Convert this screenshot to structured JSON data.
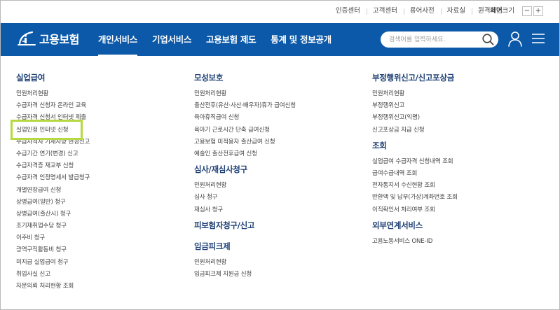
{
  "topbar": {
    "links": [
      "인증센터",
      "고객센터",
      "용어사전",
      "자료실",
      "원격제어"
    ],
    "zoom_label": "화면크기",
    "zoom_out": "−",
    "zoom_in": "+"
  },
  "header": {
    "logo_text": "고용보험",
    "nav": [
      "개인서비스",
      "기업서비스",
      "고용보험 제도",
      "통계 및 정보공개"
    ],
    "active_nav": "개인서비스",
    "search_placeholder": "검색어를 입력하세요.",
    "brand_color": "#0b59a8"
  },
  "sitemap": {
    "col1": {
      "title": "실업급여",
      "items": [
        "민원처리현황",
        "수급자격 신청자 온라인 교육",
        "수급자격 신청서 인터넷 제출",
        "실업인정 인터넷 신청",
        "수급자격자 기재사항 변경신고",
        "수급기간 연기(변경) 신고",
        "수급자격증 재교부 신청",
        "수급자격 인정명세서 발급청구",
        "개별연장급여 신청",
        "상병급여(일반) 청구",
        "상병급여(출산시) 청구",
        "조기재취업수당 청구",
        "이주비 청구",
        "광역구직활동비 청구",
        "미지급 실업급여 청구",
        "취업사실 신고",
        "자문의뢰 처리현황 조회"
      ]
    },
    "col2": [
      {
        "title": "모성보호",
        "items": [
          "민원처리현황",
          "출산전후(유산·사산·배우자)휴가 급여신청",
          "육아휴직급여 신청",
          "육아기 근로시간 단축 급여신청",
          "고용보험 미적용자 출산급여 신청",
          "예술인 출산전후급여 신청"
        ]
      },
      {
        "title": "심사/재심사청구",
        "items": [
          "민원처리현황",
          "심사 청구",
          "재심사 청구"
        ]
      },
      {
        "title": "피보험자청구/신고",
        "items": []
      },
      {
        "title": "임금피크제",
        "items": [
          "민원처리현황",
          "임금피크제 지원금 신청"
        ]
      }
    ],
    "col3": [
      {
        "title": "부정행위신고/신고포상금",
        "items": [
          "민원처리현황",
          "부정행위신고",
          "부정행위신고(익명)",
          "신고포상금 지급 신청"
        ]
      },
      {
        "title": "조회",
        "items": [
          "실업급여 수급자격 신청내역 조회",
          "급여수급내역 조회",
          "전자통지서 수신현황 조회",
          "반환액 및 납부(가상)계좌번호 조회",
          "이직확인서 처리여부 조회"
        ]
      },
      {
        "title": "외부연계서비스",
        "items": [
          "고용노동서비스 ONE-ID"
        ]
      }
    ],
    "highlight_color": "#b5d940"
  }
}
